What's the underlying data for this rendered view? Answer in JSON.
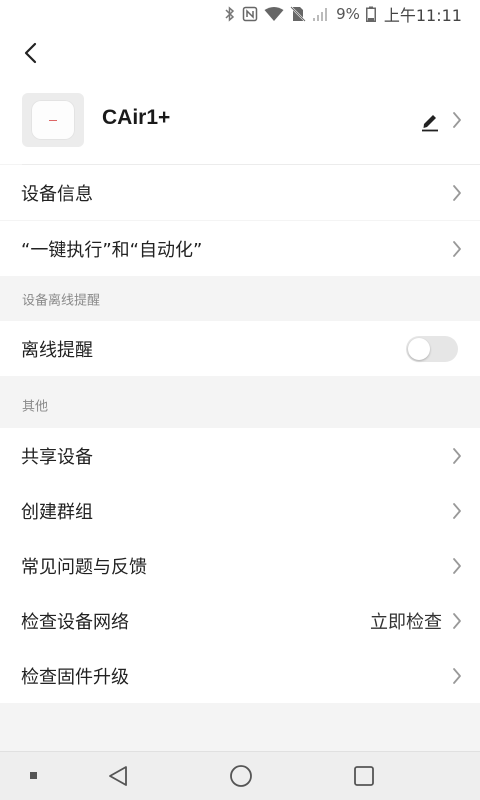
{
  "status_bar": {
    "battery_percent": "9%",
    "time": "上午11:11",
    "icons": [
      "bluetooth-icon",
      "nfc-icon",
      "wifi-icon",
      "no-sim-icon",
      "signal-icon",
      "battery-icon"
    ]
  },
  "device": {
    "name": "CAir1+"
  },
  "items": {
    "device_info": "设备信息",
    "scenes": "“一键执行”和“自动化”",
    "offline_section": "设备离线提醒",
    "offline_alert": "离线提醒",
    "offline_alert_enabled": false,
    "other_section": "其他",
    "share": "共享设备",
    "group": "创建群组",
    "faq": "常见问题与反馈",
    "network": "检查设备网络",
    "network_action": "立即检查",
    "firmware": "检查固件升级"
  },
  "colors": {
    "background": "#f4f4f4",
    "card": "#ffffff",
    "section_text": "#8a8a8a",
    "toggle_off": "#e6e6e6"
  }
}
